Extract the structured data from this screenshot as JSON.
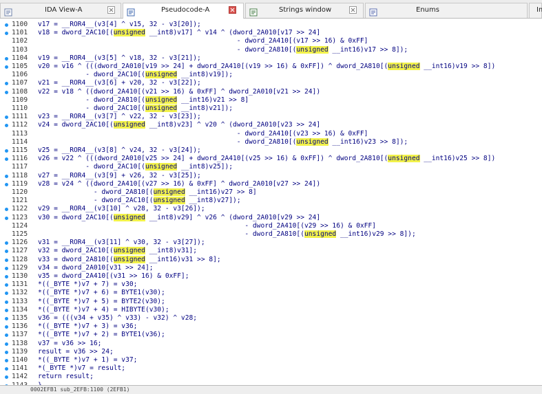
{
  "tabs": [
    {
      "label": "IDA View-A",
      "icon": "ida-view-icon",
      "active": false,
      "close": "gray"
    },
    {
      "label": "Pseudocode-A",
      "icon": "pseudocode-icon",
      "active": true,
      "close": "red"
    },
    {
      "label": "Strings window",
      "icon": "strings-icon",
      "active": false,
      "close": "gray"
    },
    {
      "label": "Enums",
      "icon": "enums-icon",
      "active": false,
      "close": "gray"
    },
    {
      "label": "Imp",
      "icon": "imports-icon",
      "active": false,
      "close": "none"
    }
  ],
  "colors": {
    "code_text": "#000080",
    "highlight": "#f2f24a",
    "bullet": "#2196f3",
    "close_active": "#d9534f"
  },
  "code_lines": [
    {
      "ln": "1100",
      "bullet": true,
      "segs": [
        "v17 = __ROR4__(v3[4] ^ v15, 32 - v3[20]);"
      ]
    },
    {
      "ln": "1101",
      "bullet": true,
      "segs": [
        "v18 = dword_2AC10[(",
        "unsigned",
        " __int8)v17] ^ v14 ^ (dword_2A010[v17 >> 24]"
      ]
    },
    {
      "ln": "1102",
      "bullet": false,
      "segs": [
        "                                                  - dword_2A410[(v17 >> 16) & 0xFF]"
      ]
    },
    {
      "ln": "1103",
      "bullet": false,
      "segs": [
        "                                                  - dword_2A810[(",
        "unsigned",
        " __int16)v17 >> 8]);"
      ]
    },
    {
      "ln": "1104",
      "bullet": true,
      "segs": [
        "v19 = __ROR4__(v3[5] ^ v18, 32 - v3[21]);"
      ]
    },
    {
      "ln": "1105",
      "bullet": true,
      "segs": [
        "v20 = v16 ^ (((dword_2A010[v19 >> 24] + dword_2A410[(v19 >> 16) & 0xFF]) ^ dword_2A810[(",
        "unsigned",
        " __int16)v19 >> 8])"
      ]
    },
    {
      "ln": "1106",
      "bullet": false,
      "segs": [
        "            - dword_2AC10[(",
        "unsigned",
        " __int8)v19]);"
      ]
    },
    {
      "ln": "1107",
      "bullet": true,
      "segs": [
        "v21 = __ROR4__(v3[6] + v20, 32 - v3[22]);"
      ]
    },
    {
      "ln": "1108",
      "bullet": true,
      "segs": [
        "v22 = v18 ^ ((dword_2A410[(v21 >> 16) & 0xFF] ^ dword_2A010[v21 >> 24])"
      ]
    },
    {
      "ln": "1109",
      "bullet": false,
      "segs": [
        "            - dword_2A810[(",
        "unsigned",
        " __int16)v21 >> 8]"
      ]
    },
    {
      "ln": "1110",
      "bullet": false,
      "segs": [
        "            - dword_2AC10[(",
        "unsigned",
        " __int8)v21]);"
      ]
    },
    {
      "ln": "1111",
      "bullet": true,
      "segs": [
        "v23 = __ROR4__(v3[7] ^ v22, 32 - v3[23]);"
      ]
    },
    {
      "ln": "1112",
      "bullet": true,
      "segs": [
        "v24 = dword_2AC10[(",
        "unsigned",
        " __int8)v23] ^ v20 ^ (dword_2A010[v23 >> 24]"
      ]
    },
    {
      "ln": "1113",
      "bullet": false,
      "segs": [
        "                                                  - dword_2A410[(v23 >> 16) & 0xFF]"
      ]
    },
    {
      "ln": "1114",
      "bullet": false,
      "segs": [
        "                                                  - dword_2A810[(",
        "unsigned",
        " __int16)v23 >> 8]);"
      ]
    },
    {
      "ln": "1115",
      "bullet": true,
      "segs": [
        "v25 = __ROR4__(v3[8] ^ v24, 32 - v3[24]);"
      ]
    },
    {
      "ln": "1116",
      "bullet": true,
      "segs": [
        "v26 = v22 ^ (((dword_2A010[v25 >> 24] + dword_2A410[(v25 >> 16) & 0xFF]) ^ dword_2A810[(",
        "unsigned",
        " __int16)v25 >> 8])"
      ]
    },
    {
      "ln": "1117",
      "bullet": false,
      "segs": [
        "            - dword_2AC10[(",
        "unsigned",
        " __int8)v25]);"
      ]
    },
    {
      "ln": "1118",
      "bullet": true,
      "segs": [
        "v27 = __ROR4__(v3[9] + v26, 32 - v3[25]);"
      ]
    },
    {
      "ln": "1119",
      "bullet": true,
      "segs": [
        "v28 = v24 ^ ((dword_2A410[(v27 >> 16) & 0xFF] ^ dword_2A010[v27 >> 24])"
      ]
    },
    {
      "ln": "1120",
      "bullet": false,
      "segs": [
        "              - dword_2A810[(",
        "unsigned",
        " __int16)v27 >> 8]"
      ]
    },
    {
      "ln": "1121",
      "bullet": false,
      "segs": [
        "              - dword_2AC10[(",
        "unsigned",
        " __int8)v27]);"
      ]
    },
    {
      "ln": "1122",
      "bullet": true,
      "segs": [
        "v29 = __ROR4__(v3[10] ^ v28, 32 - v3[26]);"
      ]
    },
    {
      "ln": "1123",
      "bullet": true,
      "segs": [
        "v30 = dword_2AC10[(",
        "unsigned",
        " __int8)v29] ^ v26 ^ (dword_2A010[v29 >> 24]"
      ]
    },
    {
      "ln": "1124",
      "bullet": false,
      "segs": [
        "                                                    - dword_2A410[(v29 >> 16) & 0xFF]"
      ]
    },
    {
      "ln": "1125",
      "bullet": false,
      "segs": [
        "                                                    - dword_2A810[(",
        "unsigned",
        " __int16)v29 >> 8]);"
      ]
    },
    {
      "ln": "1126",
      "bullet": true,
      "segs": [
        "v31 = __ROR4__(v3[11] ^ v30, 32 - v3[27]);"
      ]
    },
    {
      "ln": "1127",
      "bullet": true,
      "segs": [
        "v32 = dword_2AC10[(",
        "unsigned",
        " __int8)v31];"
      ]
    },
    {
      "ln": "1128",
      "bullet": true,
      "segs": [
        "v33 = dword_2A810[(",
        "unsigned",
        " __int16)v31 >> 8];"
      ]
    },
    {
      "ln": "1129",
      "bullet": true,
      "segs": [
        "v34 = dword_2A010[v31 >> 24];"
      ]
    },
    {
      "ln": "1130",
      "bullet": true,
      "segs": [
        "v35 = dword_2A410[(v31 >> 16) & 0xFF];"
      ]
    },
    {
      "ln": "1131",
      "bullet": true,
      "segs": [
        "*((_BYTE *)v7 + 7) = v30;"
      ]
    },
    {
      "ln": "1132",
      "bullet": true,
      "segs": [
        "*((_BYTE *)v7 + 6) = BYTE1(v30);"
      ]
    },
    {
      "ln": "1133",
      "bullet": true,
      "segs": [
        "*((_BYTE *)v7 + 5) = BYTE2(v30);"
      ]
    },
    {
      "ln": "1134",
      "bullet": true,
      "segs": [
        "*((_BYTE *)v7 + 4) = HIBYTE(v30);"
      ]
    },
    {
      "ln": "1135",
      "bullet": true,
      "segs": [
        "v36 = (((v34 + v35) ^ v33) - v32) ^ v28;"
      ]
    },
    {
      "ln": "1136",
      "bullet": true,
      "segs": [
        "*((_BYTE *)v7 + 3) = v36;"
      ]
    },
    {
      "ln": "1137",
      "bullet": true,
      "segs": [
        "*((_BYTE *)v7 + 2) = BYTE1(v36);"
      ]
    },
    {
      "ln": "1138",
      "bullet": true,
      "segs": [
        "v37 = v36 >> 16;"
      ]
    },
    {
      "ln": "1139",
      "bullet": true,
      "segs": [
        "result = v36 >> 24;"
      ]
    },
    {
      "ln": "1140",
      "bullet": true,
      "segs": [
        "*((_BYTE *)v7 + 1) = v37;"
      ]
    },
    {
      "ln": "1141",
      "bullet": true,
      "segs": [
        "*(_BYTE *)v7 = result;"
      ]
    },
    {
      "ln": "1142",
      "bullet": true,
      "segs": [
        "return result;"
      ]
    },
    {
      "ln": "1143",
      "bullet": true,
      "segs": [
        "}"
      ]
    }
  ],
  "status": {
    "text": "0002EFB1 sub_2EFB:1100 (2EFB1)"
  }
}
